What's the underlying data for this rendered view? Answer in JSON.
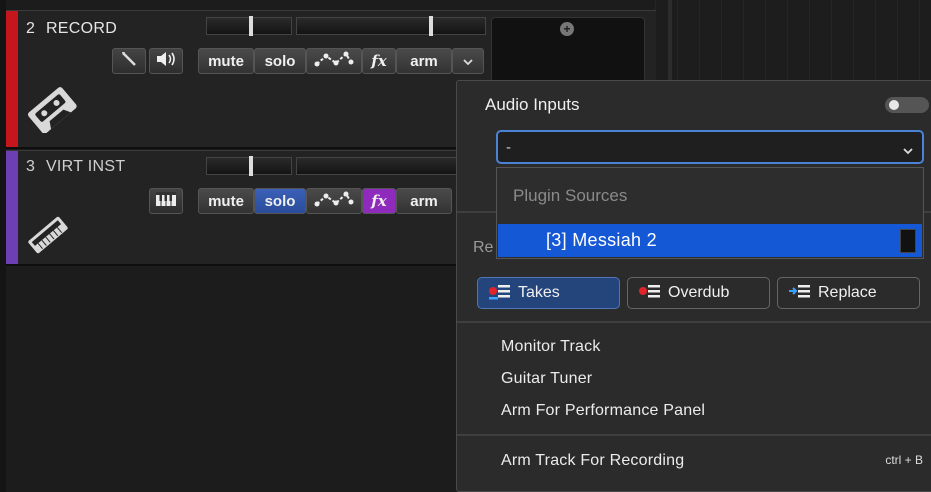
{
  "tracks": [
    {
      "number": "2",
      "name": "RECORD",
      "buttons": {
        "mute": "mute",
        "solo": "solo",
        "fx": "fx",
        "arm": "arm"
      },
      "color": "#c4161c"
    },
    {
      "number": "3",
      "name": "VIRT INST",
      "buttons": {
        "mute": "mute",
        "solo": "solo",
        "fx": "fx",
        "arm": "arm"
      },
      "color": "#6c3fb5"
    }
  ],
  "popup": {
    "title": "Audio Inputs",
    "input_value": "-",
    "dropdown": {
      "group_label": "Plugin Sources",
      "selected_item": "[3] Messiah 2"
    },
    "record_partial_label": "Re",
    "modes": {
      "takes": "Takes",
      "overdub": "Overdub",
      "replace": "Replace"
    },
    "menu": {
      "monitor_track": "Monitor Track",
      "guitar_tuner": "Guitar Tuner",
      "arm_performance": "Arm For Performance Panel",
      "arm_track": "Arm Track For Recording",
      "arm_track_shortcut": "ctrl + B"
    }
  },
  "colors": {
    "accent_blue": "#1458d6",
    "solo_active": "#3a60b8",
    "fx_active": "#8e2bbd"
  }
}
